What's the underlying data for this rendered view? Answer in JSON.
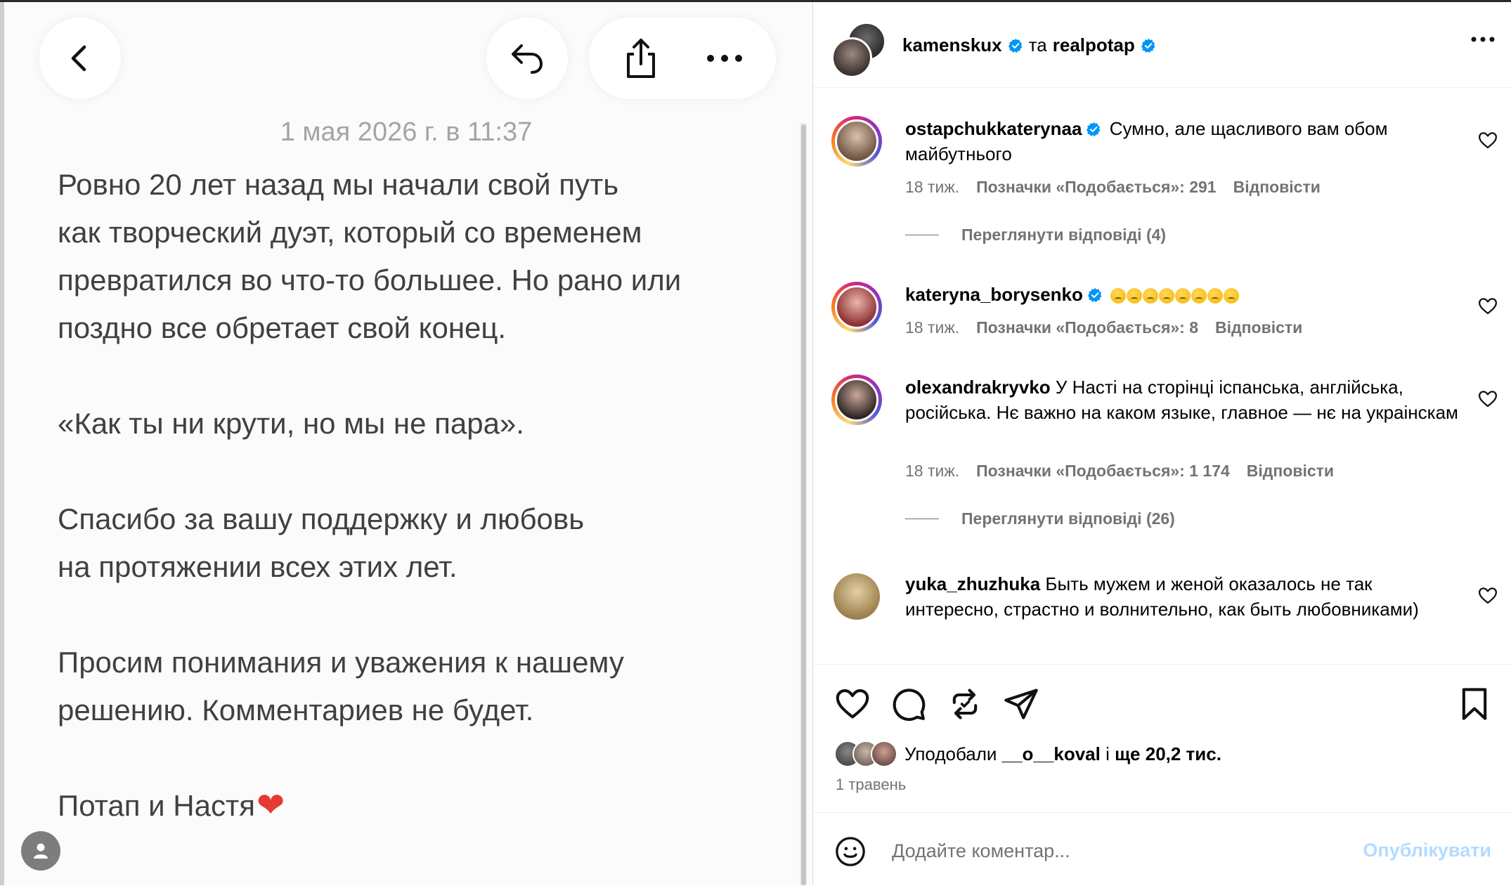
{
  "notes": {
    "date": "1 мая 2026 г. в 11:37",
    "paragraphs": [
      "Ровно 20 лет назад мы начали свой путь\nкак творческий дуэт, который со временем\nпревратился во что-то большее. Но рано или\nпоздно все обретает свой конец.",
      "«Как ты ни крути, но мы не пара».",
      "Спасибо за вашу поддержку и любовь\nна протяжении всех этих лет.",
      "Просим понимания и уважения к нашему\nрешению. Комментариев не будет."
    ],
    "signature": "Потап и Настя",
    "signature_emoji": "❤",
    "icons": [
      "chevron-left-icon",
      "reply-arrow-icon",
      "share-icon",
      "more-icon",
      "person-icon"
    ]
  },
  "post": {
    "author1": "kamenskux",
    "joiner": "та",
    "author2": "realpotap"
  },
  "comments": [
    {
      "user": "ostapchukkaterynaa",
      "verified": true,
      "text": "Сумно, але щасливого вам обом майбутнього",
      "time": "18 тиж.",
      "likes": "Позначки «Подобається»: 291",
      "reply": "Відповісти",
      "view_replies": "Переглянути відповіді (4)"
    },
    {
      "user": "kateryna_borysenko",
      "verified": true,
      "text": "😢😢😢😢😢😢😢😢",
      "time": "18 тиж.",
      "likes": "Позначки «Подобається»: 8",
      "reply": "Відповісти"
    },
    {
      "user": "olexandrakryvko",
      "verified": false,
      "text": "У Насті на сторінці іспанська, англійська, російська. Нє важно на каком языке, главное — нє на украінскам",
      "time": "18 тиж.",
      "likes": "Позначки «Подобається»: 1 174",
      "reply": "Відповісти",
      "view_replies": "Переглянути відповіді (26)"
    },
    {
      "user": "yuka_zhuzhuka",
      "verified": false,
      "text": "Быть мужем и женой оказалось не так интересно, страстно и волнительно, как быть любовниками)"
    }
  ],
  "actions": {
    "liked_prefix": "Уподобали",
    "liked_user": "__o__koval",
    "liked_conj": "і",
    "liked_rest": "ще 20,2 тис.",
    "date": "1 травень"
  },
  "composer": {
    "placeholder": "Додайте коментар...",
    "publish": "Опублікувати"
  },
  "colors": {
    "verified": "#0095f6",
    "publish_disabled": "#b3dbff",
    "secondary_text": "#737373",
    "heart": "#e53935"
  }
}
